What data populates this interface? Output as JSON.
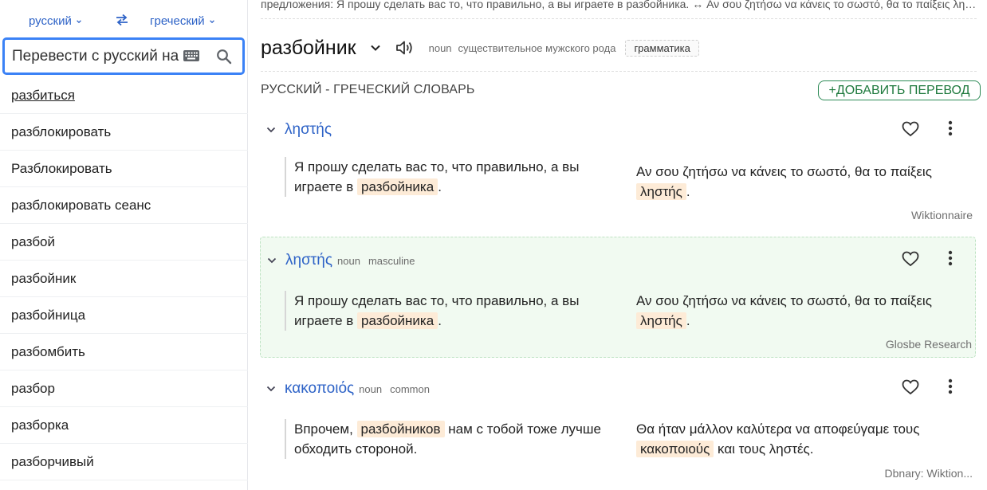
{
  "sidebar": {
    "from_lang": "русский",
    "to_lang": "греческий",
    "search_placeholder": "Перевести с русский на греческий",
    "items": [
      {
        "label": "разбиться"
      },
      {
        "label": "разблокировать"
      },
      {
        "label": "Разблокировать"
      },
      {
        "label": "разблокировать сеанс"
      },
      {
        "label": "разбой"
      },
      {
        "label": "разбойник"
      },
      {
        "label": "разбойница"
      },
      {
        "label": "разбомбить"
      },
      {
        "label": "разбор"
      },
      {
        "label": "разборка"
      },
      {
        "label": "разборчивый"
      }
    ]
  },
  "main": {
    "top_snippet": "предложения: Я прошу сделать вас то, что правильно, а вы играете в разбойника. ↔ Αν σου ζητήσω να κάνεις το σωστό, θα το παίξεις ληστής.",
    "headword": "разбойник",
    "pos": "noun",
    "pos_desc": "существительное мужского рода",
    "grammar_tag": "грамматика",
    "dict_title": "РУССКИЙ - ГРЕЧЕСКИЙ СЛОВАРЬ",
    "add_button": "+ДОБАВИТЬ ПЕРЕВОД",
    "entries": [
      {
        "word": "ληστής",
        "pos": "",
        "gender": "",
        "src_before": "Я прошу сделать вас то, что правильно, а вы играете в ",
        "src_mark": "разбойника",
        "src_after": ".",
        "tgt_before": "Αν σου ζητήσω να κάνεις το σωστό, θα το παίξεις ",
        "tgt_mark": "ληστής",
        "tgt_after": ".",
        "source": "Wiktionnaire"
      },
      {
        "word": "ληστής",
        "pos": "noun",
        "gender": "masculine",
        "src_before": "Я прошу сделать вас то, что правильно, а вы играете в ",
        "src_mark": "разбойника",
        "src_after": ".",
        "tgt_before": "Αν σου ζητήσω να κάνεις το σωστό, θα το παίξεις ",
        "tgt_mark": "ληστής",
        "tgt_after": ".",
        "source": "Glosbe Research"
      },
      {
        "word": "κακοποιός",
        "pos": "noun",
        "gender": "common",
        "src_before": "Впрочем, ",
        "src_mark": "разбойников",
        "src_after": " нам с тобой тоже лучше обходить стороной.",
        "tgt_before": "Θα ήταν μάλλον καλύτερα να αποφεύγαμε τους ",
        "tgt_mark": "κακοποιούς",
        "tgt_after": " και τους ληστές.",
        "source": "Dbnary: Wiktion..."
      }
    ]
  }
}
